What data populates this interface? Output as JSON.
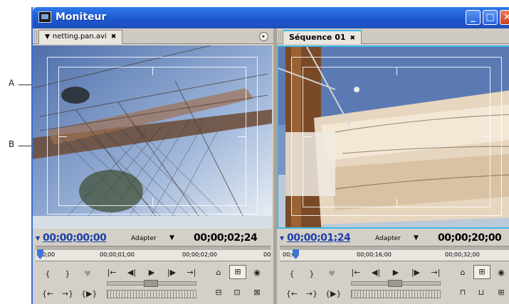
{
  "callouts": {
    "a": "A",
    "b": "B"
  },
  "window": {
    "title": "Moniteur",
    "minimize_glyph": "_",
    "maximize_glyph": "□",
    "close_glyph": "✕"
  },
  "source": {
    "tab_label": "netting.pan.avi",
    "tab_dropdown_glyph": "▼",
    "close_glyph": "✖",
    "current_timecode": "00;00;00;00",
    "fit_label": "Adapter",
    "duration_timecode": "00;00;02;24",
    "ruler_labels": [
      "00;00",
      "00;00;01;00",
      "00;00;02;00",
      "00"
    ],
    "playhead_fraction": 0.0
  },
  "program": {
    "tab_label": "Séquence 01",
    "close_glyph": "✖",
    "current_timecode": "00;00;01;24",
    "fit_label": "Adapter",
    "duration_timecode": "00;00;20;00",
    "ruler_labels": [
      "00;00",
      "00;00;16;00",
      "00;00;32;00"
    ],
    "playhead_fraction": 0.05
  },
  "icons": {
    "panel_menu": "▸",
    "dropdown": "▼",
    "mark_in": "{",
    "mark_out": "}",
    "set_marker": "♥",
    "goto_in": "|←",
    "step_back": "◀|",
    "play": "▶",
    "step_forward": "|▶",
    "goto_out": "→|",
    "loop": "⌂",
    "safe_margins": "⊞",
    "output": "◉",
    "goto_prev_edit": "{←",
    "goto_next_edit": "→}",
    "play_in_to_out": "{▶}",
    "insert": "⊟",
    "overlay": "⊡",
    "export_frame": "⊠",
    "lift": "⊓",
    "extract": "⊔",
    "trim": "⊞"
  }
}
